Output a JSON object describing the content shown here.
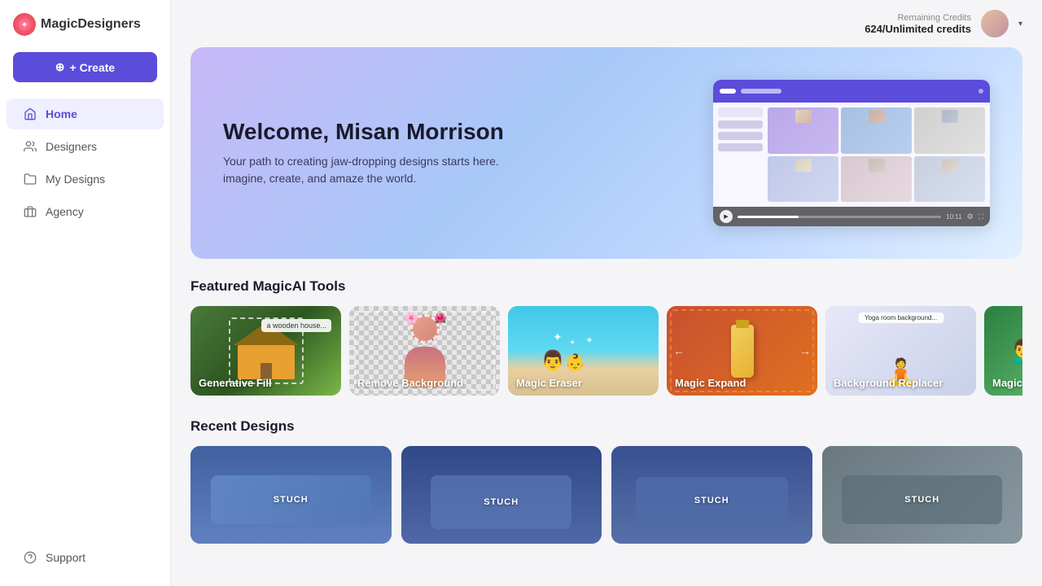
{
  "app": {
    "name": "MagicDesigners"
  },
  "sidebar": {
    "create_button": "+ Create",
    "nav_items": [
      {
        "id": "home",
        "label": "Home",
        "active": true,
        "icon": "home"
      },
      {
        "id": "designers",
        "label": "Designers",
        "active": false,
        "icon": "users"
      },
      {
        "id": "my-designs",
        "label": "My Designs",
        "active": false,
        "icon": "folder"
      },
      {
        "id": "agency",
        "label": "Agency",
        "active": false,
        "icon": "briefcase"
      }
    ],
    "support": {
      "label": "Support",
      "icon": "help-circle"
    }
  },
  "topbar": {
    "credits_label": "Remaining Credits",
    "credits_value": "624/Unlimited credits"
  },
  "hero": {
    "title": "Welcome, Misan Morrison",
    "subtitle_line1": "Your path to creating jaw-dropping designs starts here.",
    "subtitle_line2": "imagine, create, and amaze the world.",
    "video_time": "10:11"
  },
  "featured_tools": {
    "section_title": "Featured MagicAI Tools",
    "tools": [
      {
        "id": "generative-fill",
        "label": "Generative Fill",
        "theme": "generative"
      },
      {
        "id": "remove-background",
        "label": "Remove Background",
        "theme": "remove"
      },
      {
        "id": "magic-eraser",
        "label": "Magic Eraser",
        "theme": "eraser"
      },
      {
        "id": "magic-expand",
        "label": "Magic Expand",
        "theme": "expand"
      },
      {
        "id": "background-replacer",
        "label": "Background Replacer",
        "theme": "replacer"
      },
      {
        "id": "magic-upscaler",
        "label": "Magic Upscaler",
        "theme": "upscaler"
      }
    ]
  },
  "recent_designs": {
    "section_title": "Recent Designs",
    "designs": [
      {
        "id": "design-1",
        "label": "STUCH",
        "theme": "design-1"
      },
      {
        "id": "design-2",
        "label": "STUCH",
        "theme": "design-2"
      },
      {
        "id": "design-3",
        "label": "STUCH",
        "theme": "design-3"
      },
      {
        "id": "design-4",
        "label": "STUCH",
        "theme": "design-4"
      }
    ]
  }
}
